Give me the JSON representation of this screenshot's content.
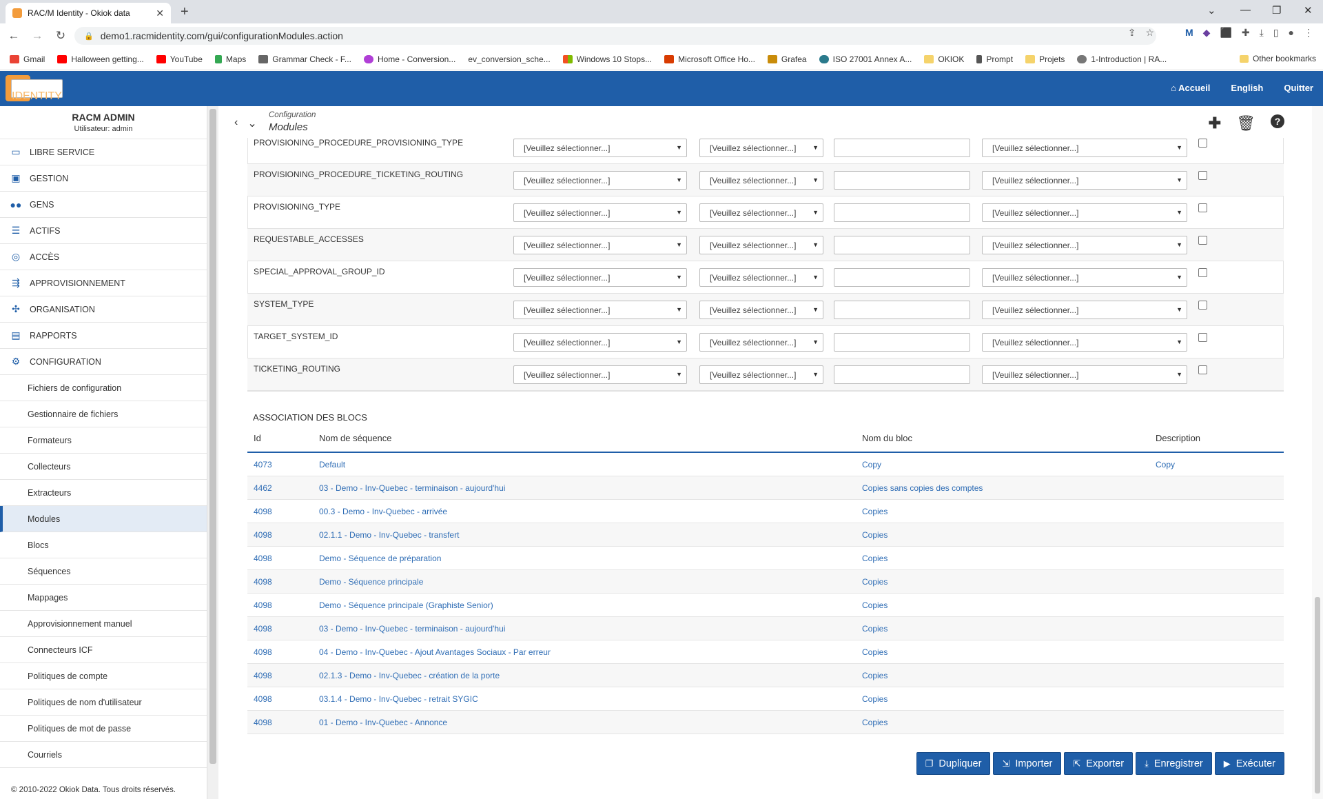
{
  "browser": {
    "tab_title": "RAC/M Identity - Okiok data",
    "url": "demo1.racmidentity.com/gui/configurationModules.action",
    "bookmarks": [
      "Gmail",
      "Halloween getting...",
      "YouTube",
      "Maps",
      "Grammar Check - F...",
      "Home - Conversion...",
      "ev_conversion_sche...",
      "Windows 10 Stops...",
      "Microsoft Office Ho...",
      "Grafea",
      "ISO 27001 Annex A...",
      "OKIOK",
      "Prompt",
      "Projets",
      "1-Introduction | RA..."
    ],
    "other_bookmarks": "Other bookmarks"
  },
  "header": {
    "logo_line1": "RAC/M",
    "logo_line2": "IDENTITY",
    "nav": [
      "Accueil",
      "English",
      "Quitter"
    ]
  },
  "sidebar": {
    "user_name": "RACM ADMIN",
    "user_label": "Utilisateur: admin",
    "items": [
      {
        "label": "LIBRE SERVICE",
        "icon": "monitor-icon"
      },
      {
        "label": "GESTION",
        "icon": "briefcase-icon"
      },
      {
        "label": "GENS",
        "icon": "users-icon"
      },
      {
        "label": "ACTIFS",
        "icon": "database-icon"
      },
      {
        "label": "ACCÈS",
        "icon": "fingerprint-icon"
      },
      {
        "label": "APPROVISIONNEMENT",
        "icon": "provisioning-icon"
      },
      {
        "label": "ORGANISATION",
        "icon": "network-icon"
      },
      {
        "label": "RAPPORTS",
        "icon": "report-icon"
      },
      {
        "label": "CONFIGURATION",
        "icon": "gears-icon"
      }
    ],
    "subitems": [
      "Fichiers de configuration",
      "Gestionnaire de fichiers",
      "Formateurs",
      "Collecteurs",
      "Extracteurs",
      "Modules",
      "Blocs",
      "Séquences",
      "Mappages",
      "Approvisionnement manuel",
      "Connecteurs ICF",
      "Politiques de compte",
      "Politiques de nom d'utilisateur",
      "Politiques de mot de passe",
      "Courriels"
    ],
    "active_subitem": "Modules",
    "footer": "© 2010-2022 Okiok Data. Tous droits réservés."
  },
  "page": {
    "breadcrumb": "Configuration",
    "title": "Modules"
  },
  "select_placeholder": "[Veuillez sélectionner...]",
  "module_rows": [
    "PROVISIONING_PROCEDURE_PROVISIONING_TYPE",
    "PROVISIONING_PROCEDURE_TICKETING_ROUTING",
    "PROVISIONING_TYPE",
    "REQUESTABLE_ACCESSES",
    "SPECIAL_APPROVAL_GROUP_ID",
    "SYSTEM_TYPE",
    "TARGET_SYSTEM_ID",
    "TICKETING_ROUTING"
  ],
  "assoc": {
    "title": "ASSOCIATION DES BLOCS",
    "headers": [
      "Id",
      "Nom de séquence",
      "Nom du bloc",
      "Description"
    ],
    "rows": [
      [
        "4073",
        "Default",
        "Copy",
        "Copy"
      ],
      [
        "4462",
        "03 - Demo - Inv-Quebec - terminaison - aujourd'hui",
        "Copies sans copies des comptes",
        ""
      ],
      [
        "4098",
        "00.3 - Demo - Inv-Quebec - arrivée",
        "Copies",
        ""
      ],
      [
        "4098",
        "02.1.1 - Demo - Inv-Quebec - transfert",
        "Copies",
        ""
      ],
      [
        "4098",
        "Demo - Séquence de préparation",
        "Copies",
        ""
      ],
      [
        "4098",
        "Demo - Séquence principale",
        "Copies",
        ""
      ],
      [
        "4098",
        "Demo - Séquence principale (Graphiste Senior)",
        "Copies",
        ""
      ],
      [
        "4098",
        "03 - Demo - Inv-Quebec - terminaison - aujourd'hui",
        "Copies",
        ""
      ],
      [
        "4098",
        "04 - Demo - Inv-Quebec - Ajout Avantages Sociaux - Par erreur",
        "Copies",
        ""
      ],
      [
        "4098",
        "02.1.3 - Demo - Inv-Quebec - création de la porte",
        "Copies",
        ""
      ],
      [
        "4098",
        "03.1.4 - Demo - Inv-Quebec - retrait SYGIC",
        "Copies",
        ""
      ],
      [
        "4098",
        "01 - Demo - Inv-Quebec - Annonce",
        "Copies",
        ""
      ]
    ]
  },
  "buttons": [
    "Dupliquer",
    "Importer",
    "Exporter",
    "Enregistrer",
    "Exécuter"
  ],
  "colors": {
    "primary": "#1f5ea8",
    "logo": "#f39c3c",
    "link": "#2f6db5"
  }
}
